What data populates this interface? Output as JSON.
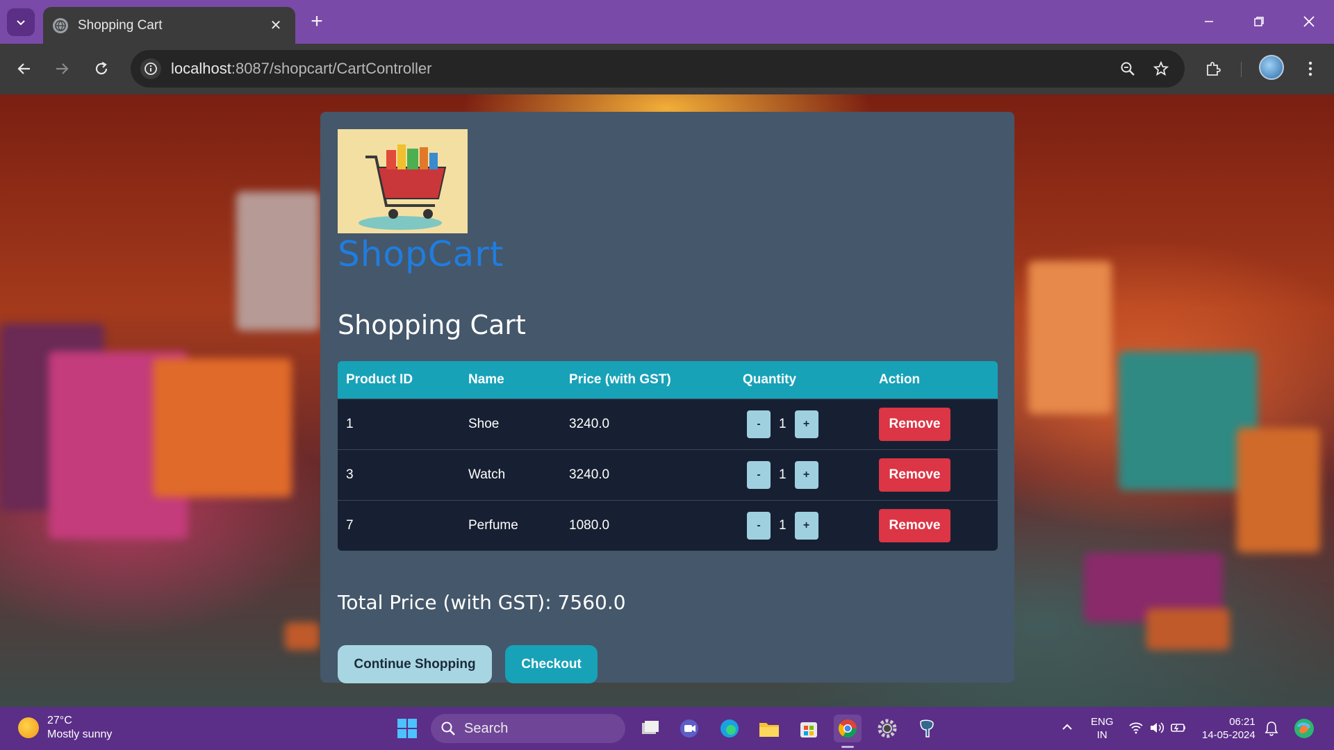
{
  "browser": {
    "tab_title": "Shopping Cart",
    "url_host": "localhost",
    "url_rest": ":8087/shopcart/CartController"
  },
  "page": {
    "brand": "ShopCart",
    "title": "Shopping Cart",
    "table": {
      "headers": [
        "Product ID",
        "Name",
        "Price (with GST)",
        "Quantity",
        "Action"
      ],
      "rows": [
        {
          "id": "1",
          "name": "Shoe",
          "price": "3240.0",
          "qty": "1",
          "action": "Remove"
        },
        {
          "id": "3",
          "name": "Watch",
          "price": "3240.0",
          "qty": "1",
          "action": "Remove"
        },
        {
          "id": "7",
          "name": "Perfume",
          "price": "1080.0",
          "qty": "1",
          "action": "Remove"
        }
      ],
      "qty_minus": "-",
      "qty_plus": "+"
    },
    "total_label": "Total Price (with GST): 7560.0",
    "continue_label": "Continue Shopping",
    "checkout_label": "Checkout",
    "colors": {
      "accent": "#17a2b8",
      "danger": "#dc3545",
      "brand": "#1f7de0"
    }
  },
  "taskbar": {
    "weather_temp": "27°C",
    "weather_desc": "Mostly sunny",
    "search_label": "Search",
    "lang_top": "ENG",
    "lang_bottom": "IN",
    "time": "06:21",
    "date": "14-05-2024"
  }
}
